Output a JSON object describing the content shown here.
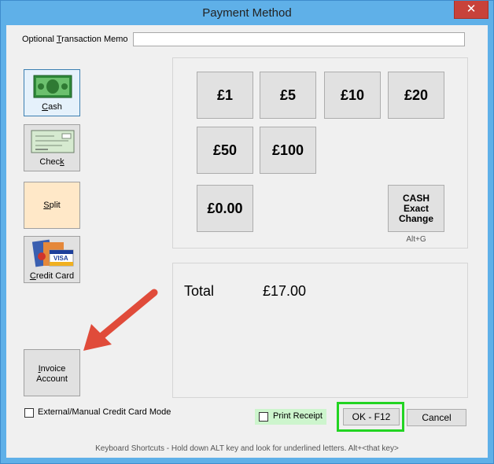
{
  "window": {
    "title": "Payment Method",
    "close_glyph": "✕"
  },
  "memo": {
    "label_pre": "Optional ",
    "label_u": "T",
    "label_post": "ransaction Memo",
    "value": ""
  },
  "side_buttons": {
    "cash": {
      "u": "C",
      "rest": "ash"
    },
    "check": {
      "pre": "Chec",
      "u": "k"
    },
    "split": {
      "u": "S",
      "rest": "plit"
    },
    "credit": {
      "u": "C",
      "rest": "redit Card"
    },
    "invoice": {
      "u": "I",
      "rest1": "nvoice",
      "line2": "Account"
    }
  },
  "cash_buttons": [
    "£1",
    "£5",
    "£10",
    "£20",
    "£50",
    "£100"
  ],
  "clear_button": "£0.00",
  "exact_change": {
    "line1": "CASH",
    "line2": "Exact",
    "line3": "Change",
    "shortcut": "Alt+G"
  },
  "total": {
    "label": "Total",
    "value": "£17.00"
  },
  "external_mode": {
    "label": "External/Manual Credit Card Mode",
    "checked": false
  },
  "print_receipt": {
    "label": "Print Receipt",
    "checked": false
  },
  "ok_button": "OK - F12",
  "cancel_button": "Cancel",
  "shortcuts_hint": "Keyboard Shortcuts - Hold down ALT key and look for underlined letters.  Alt+<that key>",
  "colors": {
    "highlight_green": "#22d422",
    "arrow_red": "#e04b3a",
    "split_bg": "#ffe8c8",
    "receipt_bg": "#cdf5cd"
  }
}
